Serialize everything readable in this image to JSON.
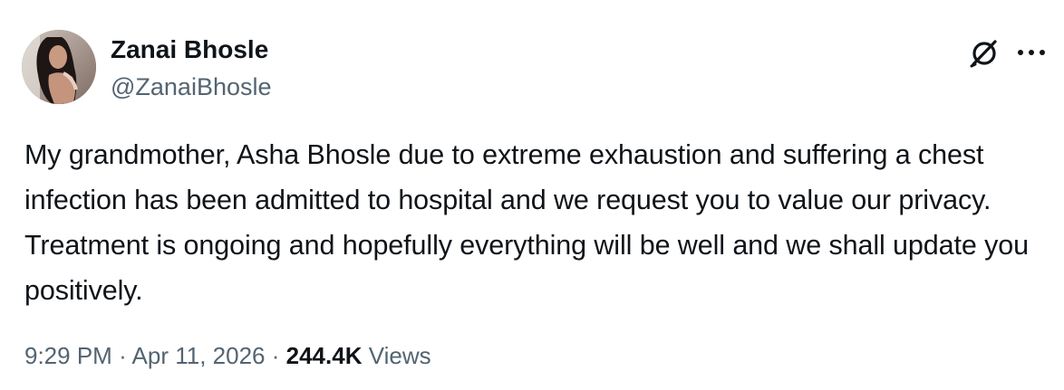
{
  "author": {
    "display_name": "Zanai Bhosle",
    "handle": "@ZanaiBhosle"
  },
  "icons": {
    "grok": "grok-icon",
    "more": "more-options-icon",
    "avatar": "profile-photo"
  },
  "tweet": {
    "text": "My grandmother, Asha Bhosle due to extreme exhaustion and suffering a chest infection has been admitted to hospital and we request you to value our privacy. Treatment is ongoing and hopefully everything will be well and we shall update you positively.",
    "time": "9:29 PM",
    "separator": "·",
    "date": "Apr 11, 2026",
    "views_count": "244.4K",
    "views_label": "Views"
  },
  "colors": {
    "text_primary": "#0f1419",
    "text_secondary": "#536471",
    "background": "#ffffff"
  }
}
